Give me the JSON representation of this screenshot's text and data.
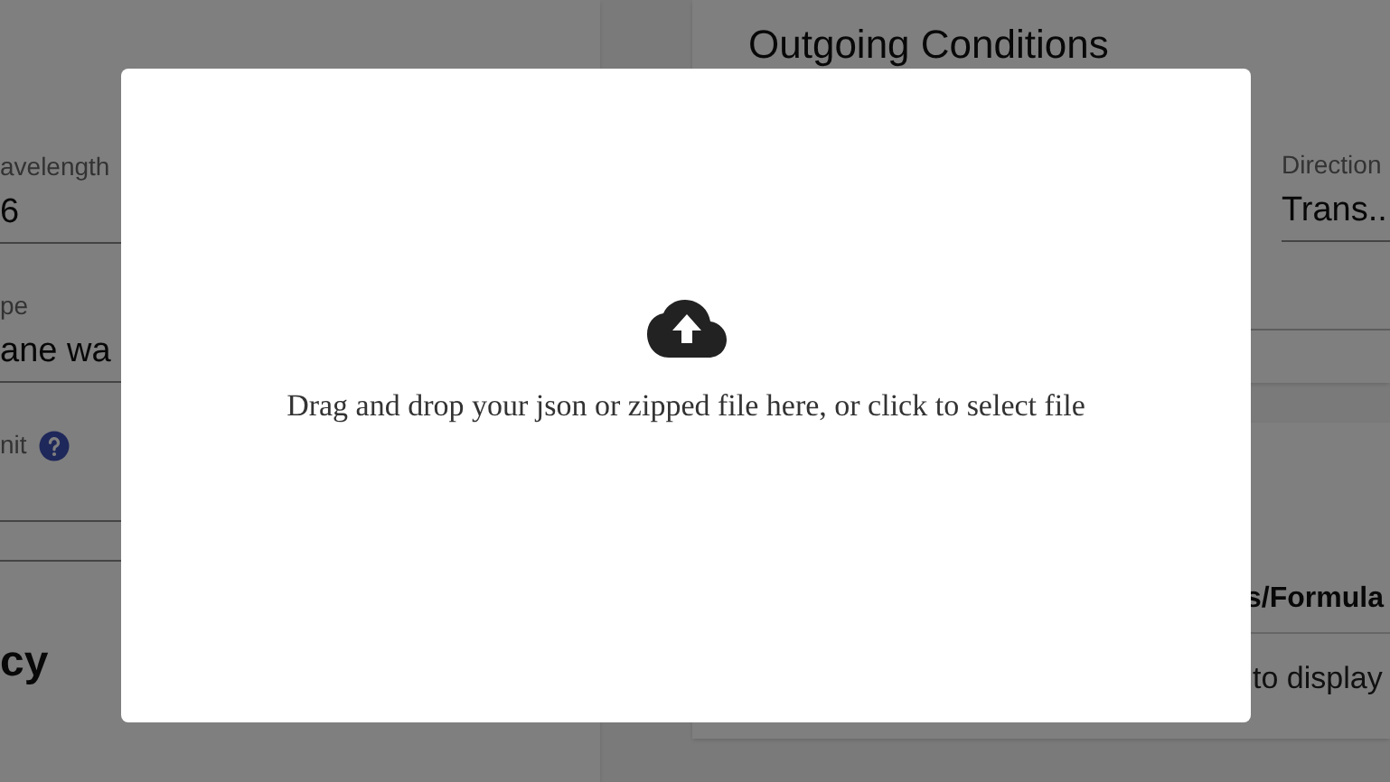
{
  "left_card": {
    "fields": [
      {
        "label": "avelength",
        "value": "6"
      },
      {
        "label": "pe",
        "value": "ane wa"
      },
      {
        "label": "nit",
        "help": true
      }
    ],
    "section_title": "cy"
  },
  "outgoing_card": {
    "title": "Outgoing Conditions",
    "fields": [
      {
        "label": "Direction",
        "value": "Trans.."
      }
    ]
  },
  "results_card": {
    "column_header": "s/Formula",
    "message": "to display"
  },
  "dialog": {
    "message": "Drag and drop your json or zipped file here, or click to select file"
  }
}
